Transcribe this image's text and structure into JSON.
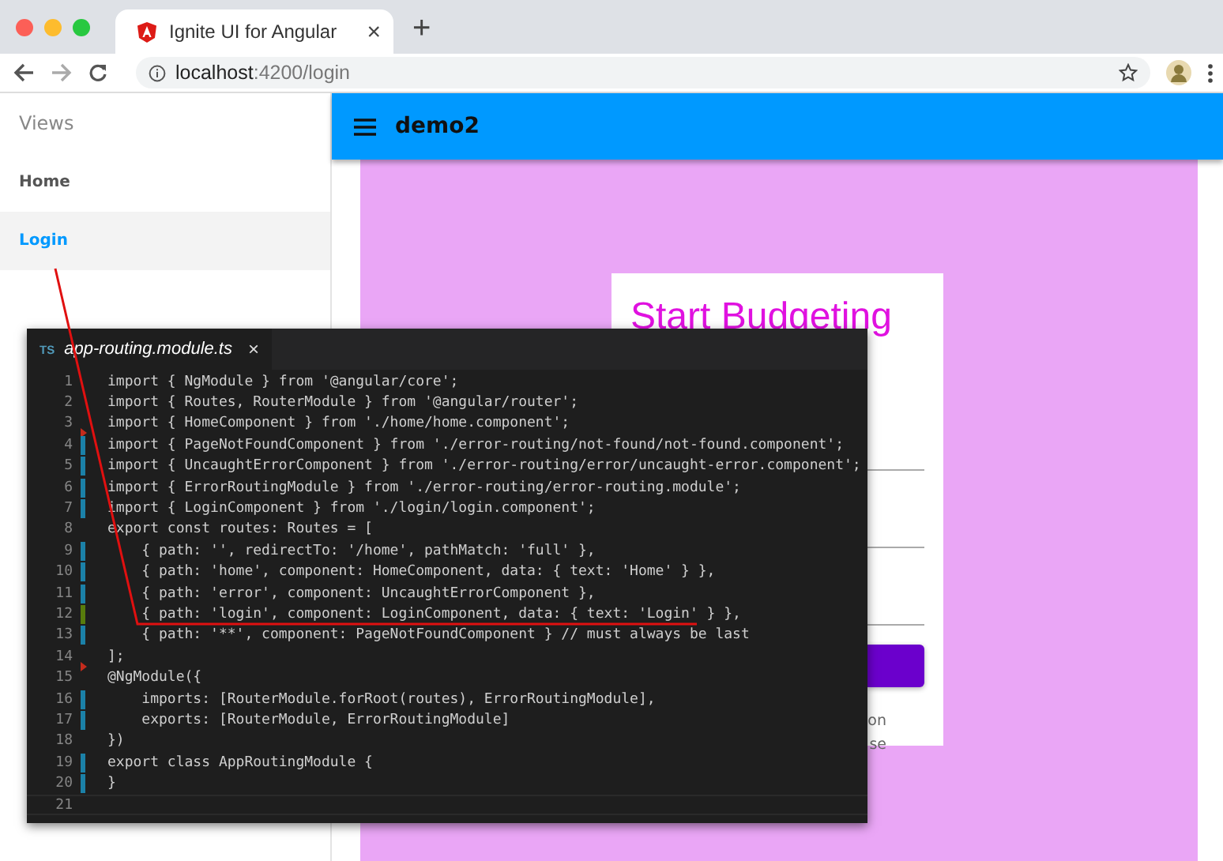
{
  "browser": {
    "tab": {
      "title": "Ignite UI for Angular",
      "close": "×"
    },
    "new_tab": "+",
    "url": {
      "host": "localhost",
      "path": ":4200/login"
    }
  },
  "sidebar": {
    "header": "Views",
    "items": [
      {
        "label": "Home",
        "selected": false
      },
      {
        "label": "Login",
        "selected": true
      }
    ]
  },
  "app_bar": {
    "title": "demo2"
  },
  "login_card": {
    "title": "Start Budgeting",
    "text_fragments": [
      "on",
      "se"
    ]
  },
  "editor": {
    "tab": {
      "icon": "TS",
      "filename": "app-routing.module.ts",
      "close": "×"
    },
    "lines": [
      {
        "number": "1",
        "code": "import { NgModule } from '@angular/core';",
        "deleted": false
      },
      {
        "number": "2",
        "code": "import { Routes, RouterModule } from '@angular/router';",
        "deleted": false
      },
      {
        "number": "3",
        "code": "import { HomeComponent } from './home/home.component';",
        "deleted": true
      },
      {
        "number": "4",
        "code": "import { PageNotFoundComponent } from './error-routing/not-found/not-found.component';",
        "deleted": false,
        "color": "#1b81a8"
      },
      {
        "number": "5",
        "code": "import { UncaughtErrorComponent } from './error-routing/error/uncaught-error.component';",
        "deleted": false,
        "color": "#1b81a8"
      },
      {
        "number": "6",
        "code": "import { ErrorRoutingModule } from './error-routing/error-routing.module';",
        "deleted": false,
        "color": "#1b81a8"
      },
      {
        "number": "7",
        "code": "import { LoginComponent } from './login/login.component';",
        "deleted": false,
        "color": "#1b81a8"
      },
      {
        "number": "8",
        "code": "export const routes: Routes = [",
        "deleted": false
      },
      {
        "number": "9",
        "code": "    { path: '', redirectTo: '/home', pathMatch: 'full' },",
        "deleted": false,
        "color": "#1b81a8"
      },
      {
        "number": "10",
        "code": "    { path: 'home', component: HomeComponent, data: { text: 'Home' } },",
        "deleted": false,
        "color": "#1b81a8"
      },
      {
        "number": "11",
        "code": "    { path: 'error', component: UncaughtErrorComponent },",
        "deleted": false,
        "color": "#1b81a8"
      },
      {
        "number": "12",
        "code": "    { path: 'login', component: LoginComponent, data: { text: 'Login' } },",
        "deleted": false,
        "color": "#587c0c"
      },
      {
        "number": "13",
        "code": "    { path: '**', component: PageNotFoundComponent } // must always be last",
        "deleted": false,
        "color": "#1b81a8"
      },
      {
        "number": "14",
        "code": "];",
        "deleted": true
      },
      {
        "number": "15",
        "code": "@NgModule({",
        "deleted": false
      },
      {
        "number": "16",
        "code": "    imports: [RouterModule.forRoot(routes), ErrorRoutingModule],",
        "deleted": false,
        "color": "#1b81a8"
      },
      {
        "number": "17",
        "code": "    exports: [RouterModule, ErrorRoutingModule]",
        "deleted": false,
        "color": "#1b81a8"
      },
      {
        "number": "18",
        "code": "})",
        "deleted": false
      },
      {
        "number": "19",
        "code": "export class AppRoutingModule {",
        "deleted": false,
        "color": "#1b81a8"
      },
      {
        "number": "20",
        "code": "}",
        "deleted": false,
        "color": "#1b81a8"
      },
      {
        "number": "21",
        "deleted": false
      }
    ]
  }
}
